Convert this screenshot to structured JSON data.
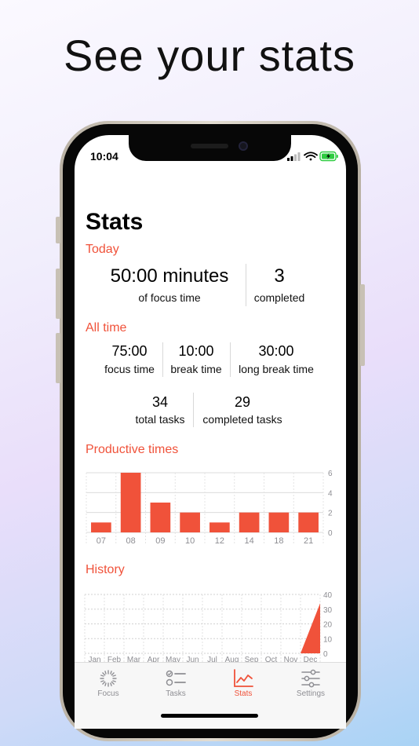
{
  "headline": "See your stats",
  "status": {
    "time": "10:04"
  },
  "page_title": "Stats",
  "today": {
    "label": "Today",
    "focus_value": "50:00 minutes",
    "focus_caption": "of focus time",
    "completed_value": "3",
    "completed_caption": "completed"
  },
  "all_time": {
    "label": "All time",
    "focus_value": "75:00",
    "focus_caption": "focus time",
    "break_value": "10:00",
    "break_caption": "break time",
    "long_break_value": "30:00",
    "long_break_caption": "long break time",
    "total_tasks_value": "34",
    "total_tasks_caption": "total tasks",
    "completed_tasks_value": "29",
    "completed_tasks_caption": "completed tasks"
  },
  "productive": {
    "label": "Productive times"
  },
  "history": {
    "label": "History"
  },
  "colors": {
    "accent": "#f0523a",
    "tab_inactive": "#8e8e93"
  },
  "tabs": [
    {
      "label": "Focus",
      "icon": "focus-icon"
    },
    {
      "label": "Tasks",
      "icon": "tasks-icon"
    },
    {
      "label": "Stats",
      "icon": "stats-icon",
      "active": true
    },
    {
      "label": "Settings",
      "icon": "settings-icon"
    }
  ],
  "chart_data": [
    {
      "type": "bar",
      "title": "Productive times",
      "categories": [
        "07",
        "08",
        "09",
        "10",
        "12",
        "14",
        "18",
        "21"
      ],
      "values": [
        1,
        6,
        3,
        2,
        1,
        2,
        2,
        2
      ],
      "ylim": [
        0,
        6
      ],
      "yticks": [
        "6",
        "4",
        "2",
        "0"
      ],
      "grid": true
    },
    {
      "type": "area",
      "title": "History",
      "categories": [
        "Jan",
        "Feb",
        "Mar",
        "Apr",
        "May",
        "Jun",
        "Jul",
        "Aug",
        "Sep",
        "Oct",
        "Nov",
        "Dec"
      ],
      "values": [
        0,
        0,
        0,
        0,
        0,
        0,
        0,
        0,
        0,
        0,
        0,
        34
      ],
      "ylim": [
        0,
        40
      ],
      "yticks": [
        "40",
        "30",
        "20",
        "10",
        "0"
      ],
      "grid": true
    }
  ]
}
